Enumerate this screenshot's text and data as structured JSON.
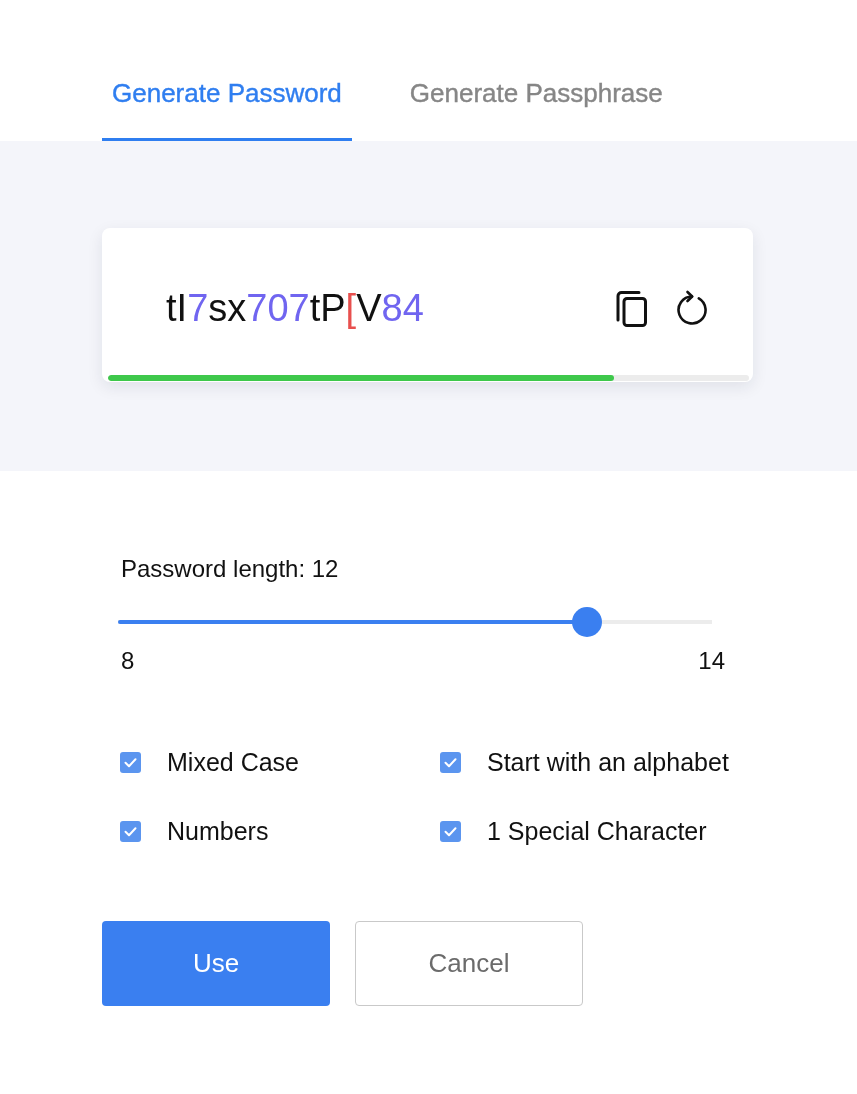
{
  "tabs": [
    {
      "label": "Generate Password",
      "selected": true
    },
    {
      "label": "Generate Passphrase",
      "selected": false
    }
  ],
  "password": {
    "segments": [
      {
        "kind": "letter",
        "text": "tI"
      },
      {
        "kind": "digit",
        "text": "7"
      },
      {
        "kind": "letter",
        "text": "sx"
      },
      {
        "kind": "digit",
        "text": "707"
      },
      {
        "kind": "letter",
        "text": "tP"
      },
      {
        "kind": "symbol",
        "text": "["
      },
      {
        "kind": "letter",
        "text": "V"
      },
      {
        "kind": "digit",
        "text": "84"
      }
    ],
    "strength": {
      "level": 0.79
    }
  },
  "length": {
    "label": "Password length: 12",
    "level": 0.79,
    "min": "8",
    "max": "14"
  },
  "options": [
    {
      "label": "Mixed Case",
      "checked": true
    },
    {
      "label": "Start with an alphabet",
      "checked": true
    },
    {
      "label": "Numbers",
      "checked": true
    },
    {
      "label": "1 Special Character",
      "checked": true
    }
  ],
  "buttons": [
    {
      "label": "Use",
      "kind": "primary"
    },
    {
      "label": "Cancel",
      "kind": "secondary"
    }
  ]
}
